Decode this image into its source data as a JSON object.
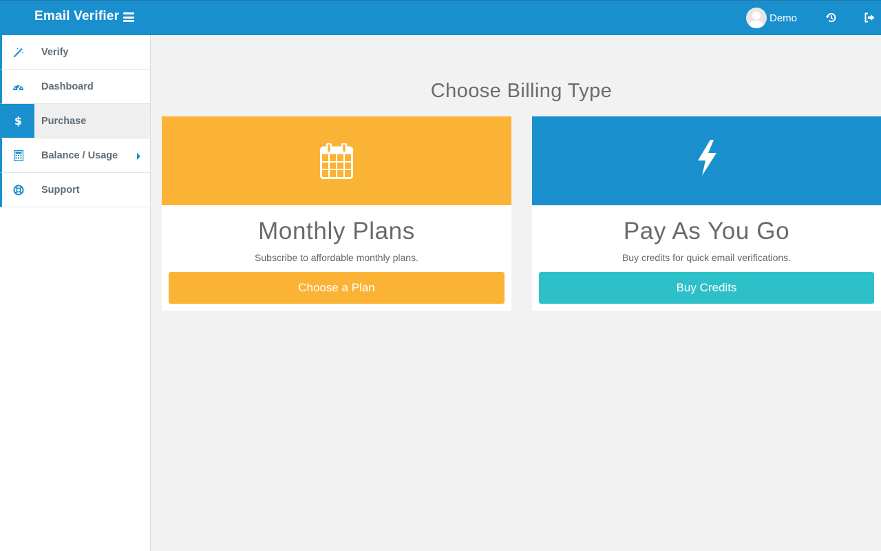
{
  "header": {
    "brand": "Email Verifier",
    "user_name": "Demo"
  },
  "sidebar": {
    "items": [
      {
        "label": "Verify",
        "icon": "magic-wand-icon"
      },
      {
        "label": "Dashboard",
        "icon": "tachometer-icon"
      },
      {
        "label": "Purchase",
        "icon": "dollar-icon",
        "active": true
      },
      {
        "label": "Balance / Usage",
        "icon": "calculator-icon",
        "has_submenu": true
      },
      {
        "label": "Support",
        "icon": "life-ring-icon"
      }
    ]
  },
  "main": {
    "title": "Choose Billing Type",
    "cards": [
      {
        "title": "Monthly Plans",
        "subtitle": "Subscribe to affordable monthly plans.",
        "button": "Choose a Plan",
        "icon": "calendar-icon",
        "color": "#fbb335",
        "button_color": "#fbb335"
      },
      {
        "title": "Pay As You Go",
        "subtitle": "Buy credits for quick email verifications.",
        "button": "Buy Credits",
        "icon": "bolt-icon",
        "color": "#1a8fcd",
        "button_color": "#2ec0c9"
      }
    ]
  },
  "colors": {
    "primary": "#1a8fcd",
    "accent_orange": "#fbb335",
    "accent_teal": "#2ec0c9",
    "background": "#f2f2f2"
  }
}
